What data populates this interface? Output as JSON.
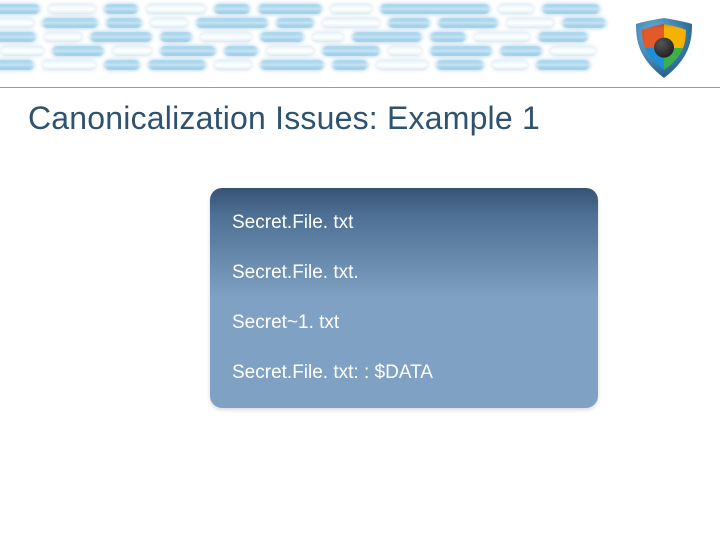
{
  "title": "Canonicalization Issues: Example 1",
  "lines": {
    "l0": "Secret.File. txt",
    "l1": "Secret.File. txt.",
    "l2": "Secret~1. txt",
    "l3": "Secret.File. txt: : $DATA"
  }
}
